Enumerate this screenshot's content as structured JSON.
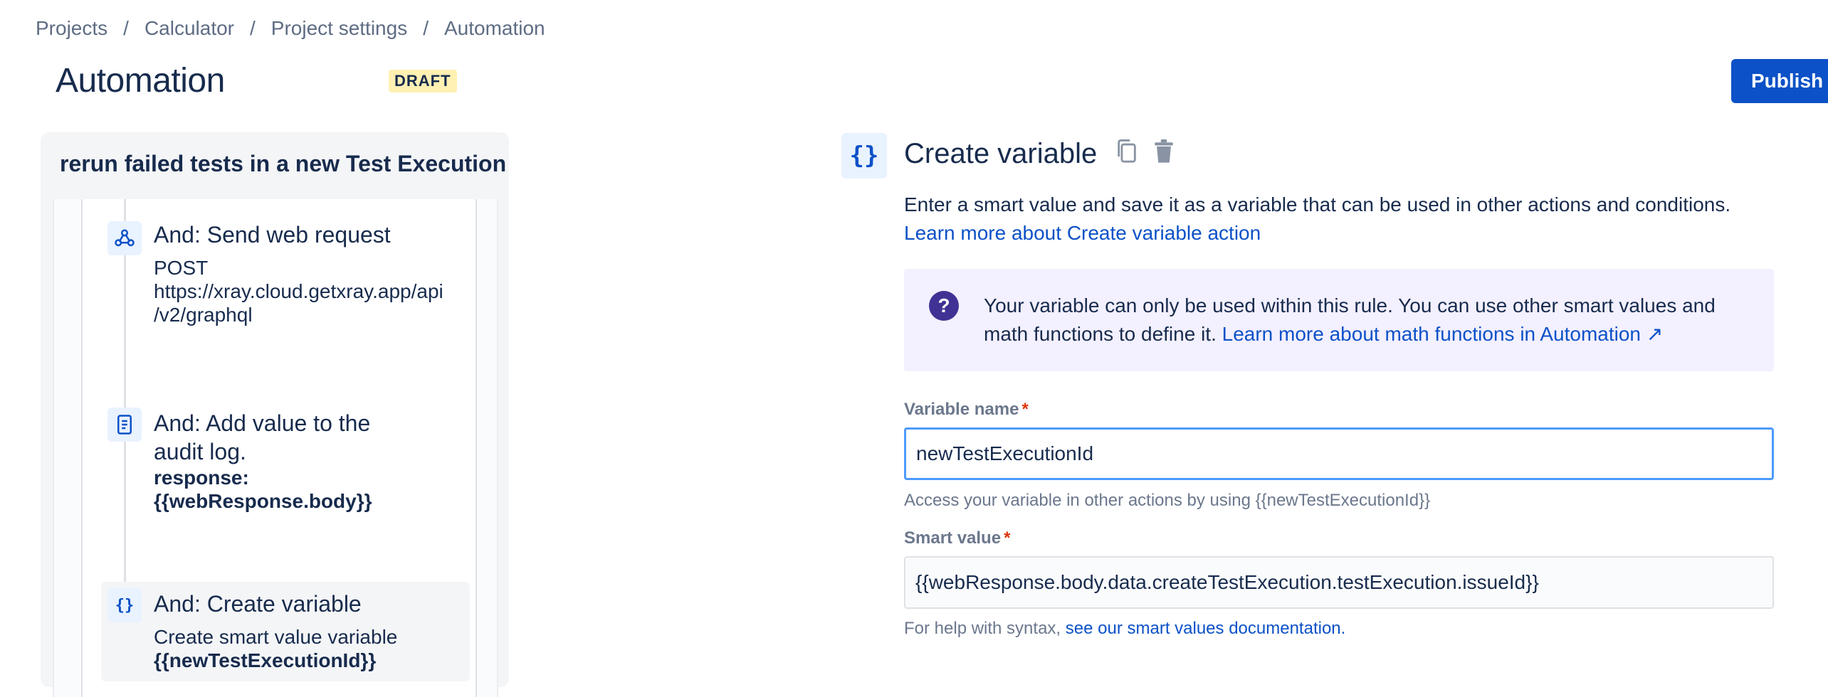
{
  "breadcrumb": [
    "Projects",
    "Calculator",
    "Project settings",
    "Automation"
  ],
  "breadcrumb_separator": "/",
  "page": {
    "title": "Automation",
    "status_badge": "DRAFT",
    "publish_label": "Publish r"
  },
  "rule": {
    "name": "rerun failed tests in a new Test Execution",
    "steps": [
      {
        "icon": "webhook-icon",
        "title": "And: Send web request",
        "lines": [
          "POST",
          "https://xray.cloud.getxray.app/api",
          "/v2/graphql"
        ]
      },
      {
        "icon": "audit-log-icon",
        "title_lines": [
          "And: Add value to the",
          "audit log."
        ],
        "bold_lines": [
          "response:",
          "{{webResponse.body}}"
        ]
      },
      {
        "icon": "variable-icon",
        "title": "And: Create variable",
        "lines": [
          "Create smart value variable"
        ],
        "bold_lines": [
          "{{newTestExecutionId}}"
        ]
      }
    ]
  },
  "panel": {
    "icon_glyph": "{}",
    "title": "Create variable",
    "description": "Enter a smart value and save it as a variable that can be used in other actions and conditions.",
    "learn_more_link": "Learn more about Create variable action",
    "info": {
      "line1": "Your variable can only be used within this rule. You can use other smart values and",
      "line2_text": "math functions to define it.",
      "line2_link": "Learn more about math functions in Automation ↗",
      "icon_glyph": "?"
    },
    "fields": {
      "variable_name_label": "Variable name",
      "variable_name_value": "newTestExecutionId",
      "variable_name_help": "Access your variable in other actions by using {{newTestExecutionId}}",
      "smart_value_label": "Smart value",
      "smart_value_value": "{{webResponse.body.data.createTestExecution.testExecution.issueId}}",
      "smart_value_help_text": "For help with syntax,",
      "smart_value_help_link": "see our smart values documentation.",
      "required_marker": "*"
    }
  },
  "colors": {
    "accent": "#0c51c7",
    "info_bg": "#f3f0ff",
    "info_icon": "#403294",
    "badge_bg": "#fff0b3",
    "required": "#de350b",
    "focus_border": "#4c9aff"
  }
}
